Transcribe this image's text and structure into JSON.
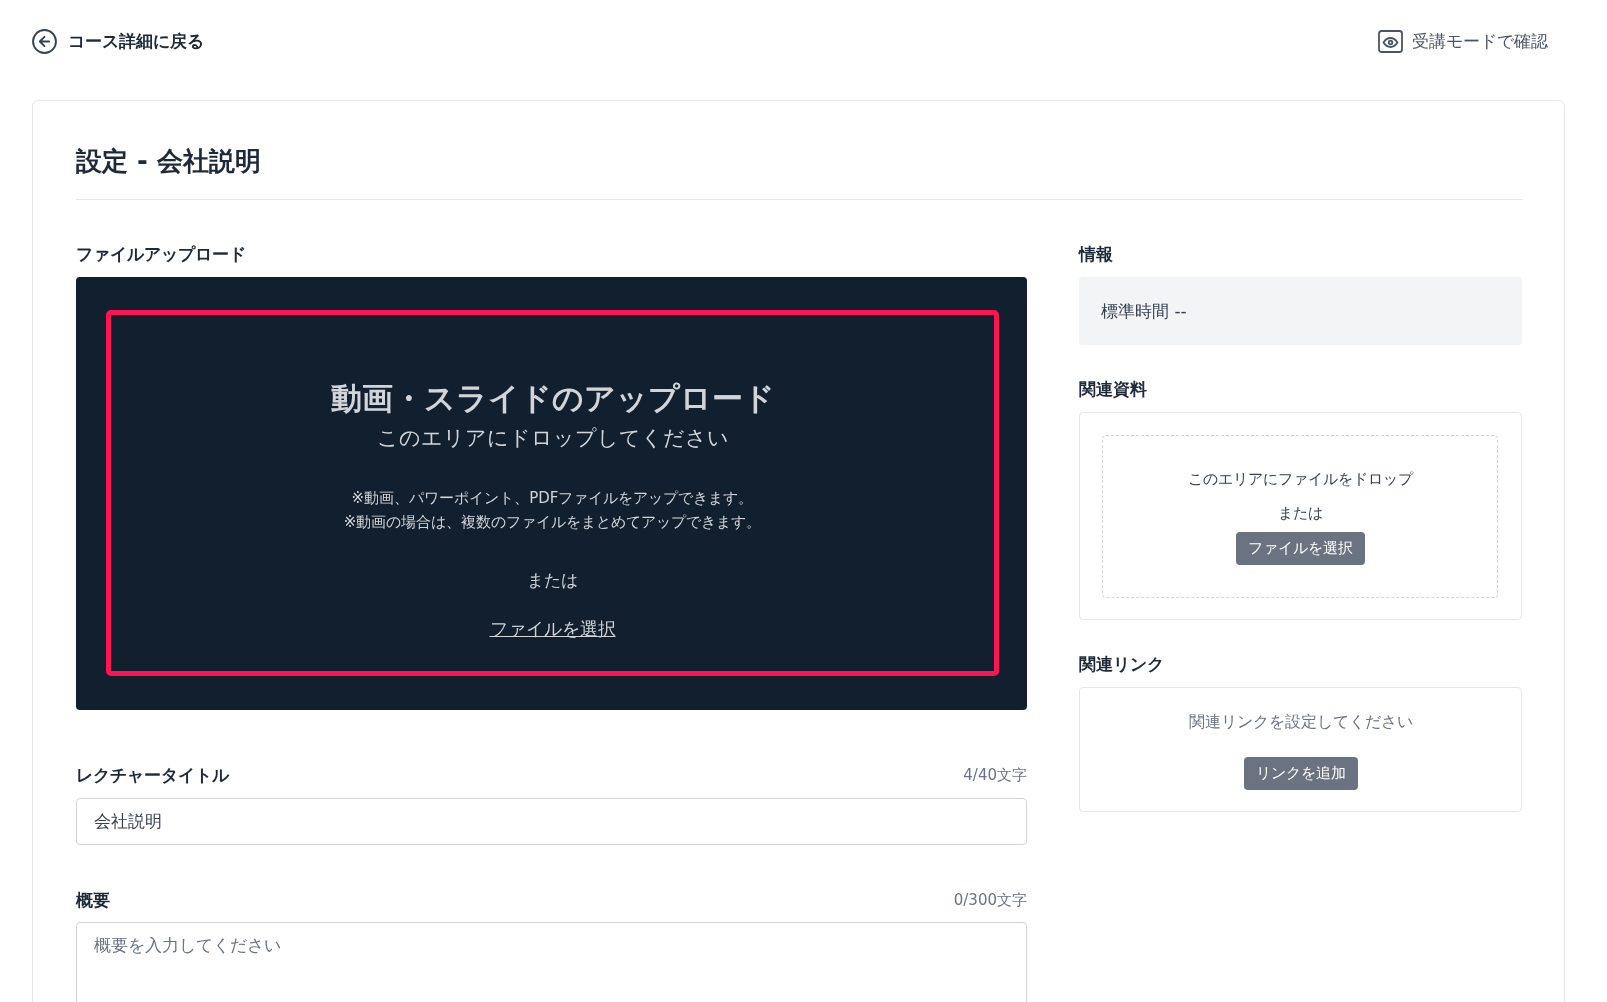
{
  "header": {
    "back_link": "コース詳細に戻る",
    "preview_link": "受講モードで確認"
  },
  "page": {
    "title": "設定 - 会社説明"
  },
  "file_upload": {
    "label": "ファイルアップロード",
    "dropzone": {
      "highlighted": true,
      "heading": "動画・スライドのアップロード",
      "subheading": "このエリアにドロップしてください",
      "notes": [
        "※動画、パワーポイント、PDFファイルをアップできます。",
        "※動画の場合は、複数のファイルをまとめてアップできます。"
      ],
      "separator": "または",
      "select_link": "ファイルを選択"
    }
  },
  "lecture_title": {
    "label": "レクチャータイトル",
    "counter": "4/40文字",
    "value": "会社説明"
  },
  "summary": {
    "label": "概要",
    "counter": "0/300文字",
    "placeholder": "概要を入力してください"
  },
  "info": {
    "label": "情報",
    "text": "標準時間 --"
  },
  "related_materials": {
    "label": "関連資料",
    "drop_text": "このエリアにファイルをドロップ",
    "separator": "または",
    "button": "ファイルを選択"
  },
  "related_links": {
    "label": "関連リンク",
    "empty_text": "関連リンクを設定してください",
    "button": "リンクを追加"
  }
}
